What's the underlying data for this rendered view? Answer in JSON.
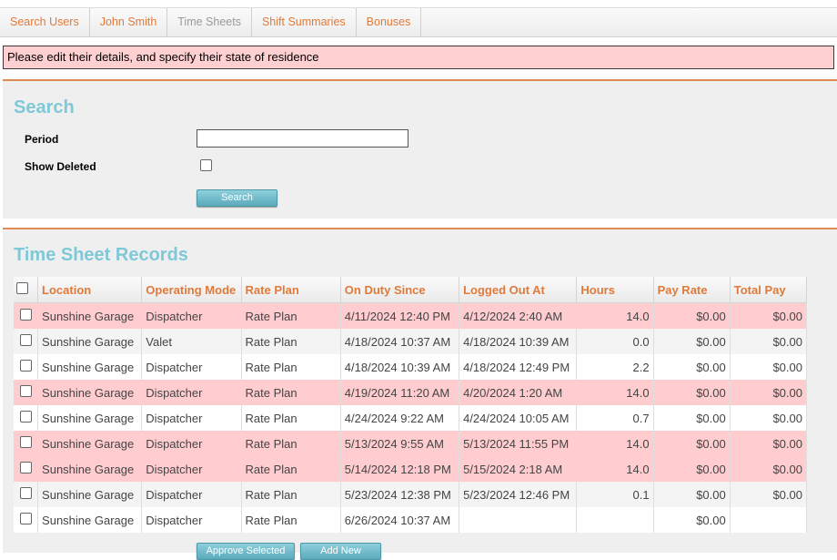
{
  "tabs": [
    {
      "label": "Search Users",
      "active": true
    },
    {
      "label": "John Smith",
      "active": true
    },
    {
      "label": "Time Sheets",
      "active": false
    },
    {
      "label": "Shift Summaries",
      "active": true
    },
    {
      "label": "Bonuses",
      "active": true
    }
  ],
  "alert": {
    "message": "Please edit their details, and specify their state of residence"
  },
  "search": {
    "heading": "Search",
    "period_label": "Period",
    "period_value": "",
    "show_deleted_label": "Show Deleted",
    "search_button": "Search"
  },
  "records": {
    "heading": "Time Sheet Records",
    "columns": [
      "Location",
      "Operating Mode",
      "Rate Plan",
      "On Duty Since",
      "Logged Out At",
      "Hours",
      "Pay Rate",
      "Total Pay"
    ],
    "rows": [
      {
        "location": "Sunshine Garage",
        "mode": "Dispatcher",
        "plan": "Rate Plan",
        "on_duty": "4/11/2024 12:40 PM",
        "logged_out": "4/12/2024 2:40 AM",
        "hours": "14.0",
        "rate": "$0.00",
        "total": "$0.00",
        "flagged": true
      },
      {
        "location": "Sunshine Garage",
        "mode": "Valet",
        "plan": "Rate Plan",
        "on_duty": "4/18/2024 10:37 AM",
        "logged_out": "4/18/2024 10:39 AM",
        "hours": "0.0",
        "rate": "$0.00",
        "total": "$0.00",
        "flagged": false
      },
      {
        "location": "Sunshine Garage",
        "mode": "Dispatcher",
        "plan": "Rate Plan",
        "on_duty": "4/18/2024 10:39 AM",
        "logged_out": "4/18/2024 12:49 PM",
        "hours": "2.2",
        "rate": "$0.00",
        "total": "$0.00",
        "flagged": false
      },
      {
        "location": "Sunshine Garage",
        "mode": "Dispatcher",
        "plan": "Rate Plan",
        "on_duty": "4/19/2024 11:20 AM",
        "logged_out": "4/20/2024 1:20 AM",
        "hours": "14.0",
        "rate": "$0.00",
        "total": "$0.00",
        "flagged": true
      },
      {
        "location": "Sunshine Garage",
        "mode": "Dispatcher",
        "plan": "Rate Plan",
        "on_duty": "4/24/2024 9:22 AM",
        "logged_out": "4/24/2024 10:05 AM",
        "hours": "0.7",
        "rate": "$0.00",
        "total": "$0.00",
        "flagged": false
      },
      {
        "location": "Sunshine Garage",
        "mode": "Dispatcher",
        "plan": "Rate Plan",
        "on_duty": "5/13/2024 9:55 AM",
        "logged_out": "5/13/2024 11:55 PM",
        "hours": "14.0",
        "rate": "$0.00",
        "total": "$0.00",
        "flagged": true
      },
      {
        "location": "Sunshine Garage",
        "mode": "Dispatcher",
        "plan": "Rate Plan",
        "on_duty": "5/14/2024 12:18 PM",
        "logged_out": "5/15/2024 2:18 AM",
        "hours": "14.0",
        "rate": "$0.00",
        "total": "$0.00",
        "flagged": true
      },
      {
        "location": "Sunshine Garage",
        "mode": "Dispatcher",
        "plan": "Rate Plan",
        "on_duty": "5/23/2024 12:38 PM",
        "logged_out": "5/23/2024 12:46 PM",
        "hours": "0.1",
        "rate": "$0.00",
        "total": "$0.00",
        "flagged": false
      },
      {
        "location": "Sunshine Garage",
        "mode": "Dispatcher",
        "plan": "Rate Plan",
        "on_duty": "6/26/2024 10:37 AM",
        "logged_out": "",
        "hours": "",
        "rate": "$0.00",
        "total": "",
        "flagged": false
      }
    ],
    "approve_button": "Approve Selected",
    "add_button": "Add New"
  },
  "colors": {
    "accent": "#e07a3a",
    "heading": "#7ec8d8",
    "flag_row": "#ffcdd0",
    "button": "#5aaabb"
  }
}
